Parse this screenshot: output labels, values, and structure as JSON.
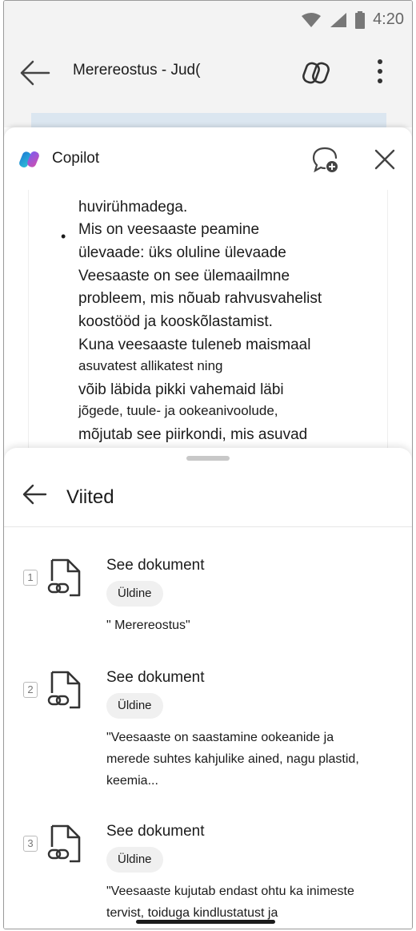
{
  "status": {
    "time": "4:20"
  },
  "appbar": {
    "title": "Merereostus - Jud("
  },
  "copilot": {
    "label": "Copilot",
    "chat_lines": [
      "huvirühmadega.",
      "Mis on veesaaste peamine",
      "ülevaade: üks oluline ülevaade",
      "Veesaaste on see ülemaailmne",
      "probleem, mis nõuab rahvusvahelist",
      "koostööd ja kooskõlastamist.",
      "Kuna veesaaste tuleneb maismaal",
      "asuvatest allikatest ning",
      "võib läbida pikki vahemaid läbi",
      "jõgede, tuule- ja ookeanivoolude,",
      "mõjutab see piirkondi, mis asuvad"
    ]
  },
  "references": {
    "title": "Viited",
    "items": [
      {
        "num": "1",
        "title": "See dokument",
        "chip": "Üldine",
        "quote": "\" Merereostus\""
      },
      {
        "num": "2",
        "title": "See dokument",
        "chip": "Üldine",
        "quote": "\"Veesaaste on saastamine ookeanide ja merede suhtes kahjulike ained, nagu plastid, keemia..."
      },
      {
        "num": "3",
        "title": "See dokument",
        "chip": "Üldine",
        "quote": "\"Veesaaste kujutab endast ohtu ka inimeste tervist, toiduga kindlustatust ja"
      }
    ]
  }
}
